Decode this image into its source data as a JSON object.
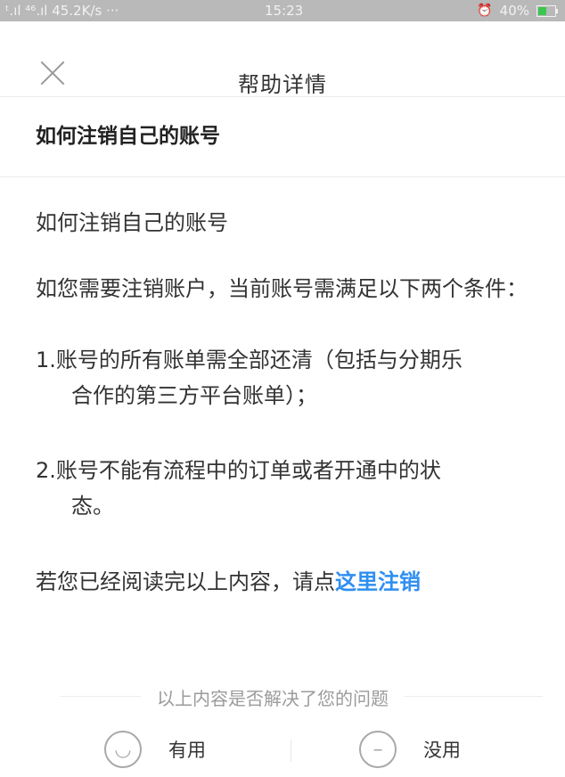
{
  "status_bar": {
    "left": "ᵗ.ıl ⁴⁶.ıl 45.2K/s ···",
    "time": "15:23",
    "alarm_icon": "alarm-icon",
    "battery_percent": "40%"
  },
  "nav": {
    "title": "帮助详情",
    "close_icon": "close-icon"
  },
  "article": {
    "title": "如何注销自己的账号",
    "paragraphs": {
      "p1": "如何注销自己的账号",
      "p2": "如您需要注销账户，当前账号需满足以下两个条件：",
      "p3_line1": "1.账号的所有账单需全部还清（包括与分期乐",
      "p3_line2": "合作的第三方平台账单）；",
      "p4_line1": "2.账号不能有流程中的订单或者开通中的状",
      "p4_line2": "态。",
      "p5_prefix": "若您已经阅读完以上内容，请点",
      "p5_link": "这里注销"
    }
  },
  "feedback": {
    "question": "以上内容是否解决了您的问题",
    "useful_label": "有用",
    "useless_label": "没用",
    "smile_icon": "smile-face-icon",
    "neutral_icon": "neutral-face-icon"
  }
}
